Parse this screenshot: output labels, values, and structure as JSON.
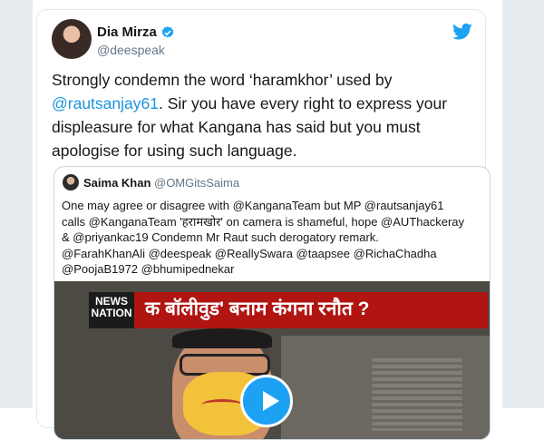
{
  "author": {
    "name": "Dia Mirza",
    "handle": "@deespeak"
  },
  "tweet": {
    "part1": "Strongly condemn the word ‘haramkhor’ used by",
    "mention": "@rautsanjay61",
    "part2": ". Sir you have every right to express your displeasure for what Kangana has said but you must apologise for using such language."
  },
  "quoted": {
    "name": "Saima Khan",
    "handle": "@OMGitsSaima",
    "text": "One may agree or disagree with @KanganaTeam but MP @rautsanjay61 calls @KanganaTeam 'हरामखोर' on camera is shameful, hope @AUThackeray & @priyankac19 Condemn  Mr Raut such derogatory remark. @FarahKhanAli @deespeak @ReallySwara @taapsee @RichaChadha @PoojaB1972 @bhumipednekar"
  },
  "media": {
    "logo": "NEWS NATION",
    "headline": "क बॉलीवुड' बनाम कंगना रनौत ?"
  },
  "colors": {
    "link": "#1b95e0",
    "verified": "#1da1f2",
    "twitter": "#1da1f2",
    "banner": "#b01512"
  }
}
